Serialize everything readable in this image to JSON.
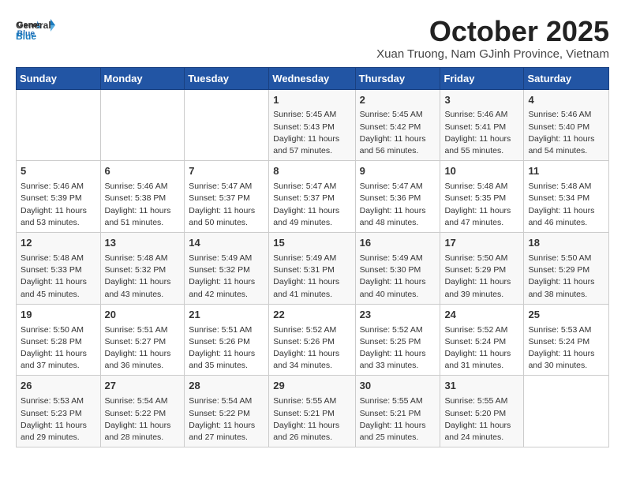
{
  "header": {
    "logo_general": "General",
    "logo_blue": "Blue",
    "month": "October 2025",
    "location": "Xuan Truong, Nam GJinh Province, Vietnam"
  },
  "weekdays": [
    "Sunday",
    "Monday",
    "Tuesday",
    "Wednesday",
    "Thursday",
    "Friday",
    "Saturday"
  ],
  "weeks": [
    [
      {
        "day": "",
        "content": ""
      },
      {
        "day": "",
        "content": ""
      },
      {
        "day": "",
        "content": ""
      },
      {
        "day": "1",
        "content": "Sunrise: 5:45 AM\nSunset: 5:43 PM\nDaylight: 11 hours and 57 minutes."
      },
      {
        "day": "2",
        "content": "Sunrise: 5:45 AM\nSunset: 5:42 PM\nDaylight: 11 hours and 56 minutes."
      },
      {
        "day": "3",
        "content": "Sunrise: 5:46 AM\nSunset: 5:41 PM\nDaylight: 11 hours and 55 minutes."
      },
      {
        "day": "4",
        "content": "Sunrise: 5:46 AM\nSunset: 5:40 PM\nDaylight: 11 hours and 54 minutes."
      }
    ],
    [
      {
        "day": "5",
        "content": "Sunrise: 5:46 AM\nSunset: 5:39 PM\nDaylight: 11 hours and 53 minutes."
      },
      {
        "day": "6",
        "content": "Sunrise: 5:46 AM\nSunset: 5:38 PM\nDaylight: 11 hours and 51 minutes."
      },
      {
        "day": "7",
        "content": "Sunrise: 5:47 AM\nSunset: 5:37 PM\nDaylight: 11 hours and 50 minutes."
      },
      {
        "day": "8",
        "content": "Sunrise: 5:47 AM\nSunset: 5:37 PM\nDaylight: 11 hours and 49 minutes."
      },
      {
        "day": "9",
        "content": "Sunrise: 5:47 AM\nSunset: 5:36 PM\nDaylight: 11 hours and 48 minutes."
      },
      {
        "day": "10",
        "content": "Sunrise: 5:48 AM\nSunset: 5:35 PM\nDaylight: 11 hours and 47 minutes."
      },
      {
        "day": "11",
        "content": "Sunrise: 5:48 AM\nSunset: 5:34 PM\nDaylight: 11 hours and 46 minutes."
      }
    ],
    [
      {
        "day": "12",
        "content": "Sunrise: 5:48 AM\nSunset: 5:33 PM\nDaylight: 11 hours and 45 minutes."
      },
      {
        "day": "13",
        "content": "Sunrise: 5:48 AM\nSunset: 5:32 PM\nDaylight: 11 hours and 43 minutes."
      },
      {
        "day": "14",
        "content": "Sunrise: 5:49 AM\nSunset: 5:32 PM\nDaylight: 11 hours and 42 minutes."
      },
      {
        "day": "15",
        "content": "Sunrise: 5:49 AM\nSunset: 5:31 PM\nDaylight: 11 hours and 41 minutes."
      },
      {
        "day": "16",
        "content": "Sunrise: 5:49 AM\nSunset: 5:30 PM\nDaylight: 11 hours and 40 minutes."
      },
      {
        "day": "17",
        "content": "Sunrise: 5:50 AM\nSunset: 5:29 PM\nDaylight: 11 hours and 39 minutes."
      },
      {
        "day": "18",
        "content": "Sunrise: 5:50 AM\nSunset: 5:29 PM\nDaylight: 11 hours and 38 minutes."
      }
    ],
    [
      {
        "day": "19",
        "content": "Sunrise: 5:50 AM\nSunset: 5:28 PM\nDaylight: 11 hours and 37 minutes."
      },
      {
        "day": "20",
        "content": "Sunrise: 5:51 AM\nSunset: 5:27 PM\nDaylight: 11 hours and 36 minutes."
      },
      {
        "day": "21",
        "content": "Sunrise: 5:51 AM\nSunset: 5:26 PM\nDaylight: 11 hours and 35 minutes."
      },
      {
        "day": "22",
        "content": "Sunrise: 5:52 AM\nSunset: 5:26 PM\nDaylight: 11 hours and 34 minutes."
      },
      {
        "day": "23",
        "content": "Sunrise: 5:52 AM\nSunset: 5:25 PM\nDaylight: 11 hours and 33 minutes."
      },
      {
        "day": "24",
        "content": "Sunrise: 5:52 AM\nSunset: 5:24 PM\nDaylight: 11 hours and 31 minutes."
      },
      {
        "day": "25",
        "content": "Sunrise: 5:53 AM\nSunset: 5:24 PM\nDaylight: 11 hours and 30 minutes."
      }
    ],
    [
      {
        "day": "26",
        "content": "Sunrise: 5:53 AM\nSunset: 5:23 PM\nDaylight: 11 hours and 29 minutes."
      },
      {
        "day": "27",
        "content": "Sunrise: 5:54 AM\nSunset: 5:22 PM\nDaylight: 11 hours and 28 minutes."
      },
      {
        "day": "28",
        "content": "Sunrise: 5:54 AM\nSunset: 5:22 PM\nDaylight: 11 hours and 27 minutes."
      },
      {
        "day": "29",
        "content": "Sunrise: 5:55 AM\nSunset: 5:21 PM\nDaylight: 11 hours and 26 minutes."
      },
      {
        "day": "30",
        "content": "Sunrise: 5:55 AM\nSunset: 5:21 PM\nDaylight: 11 hours and 25 minutes."
      },
      {
        "day": "31",
        "content": "Sunrise: 5:55 AM\nSunset: 5:20 PM\nDaylight: 11 hours and 24 minutes."
      },
      {
        "day": "",
        "content": ""
      }
    ]
  ]
}
